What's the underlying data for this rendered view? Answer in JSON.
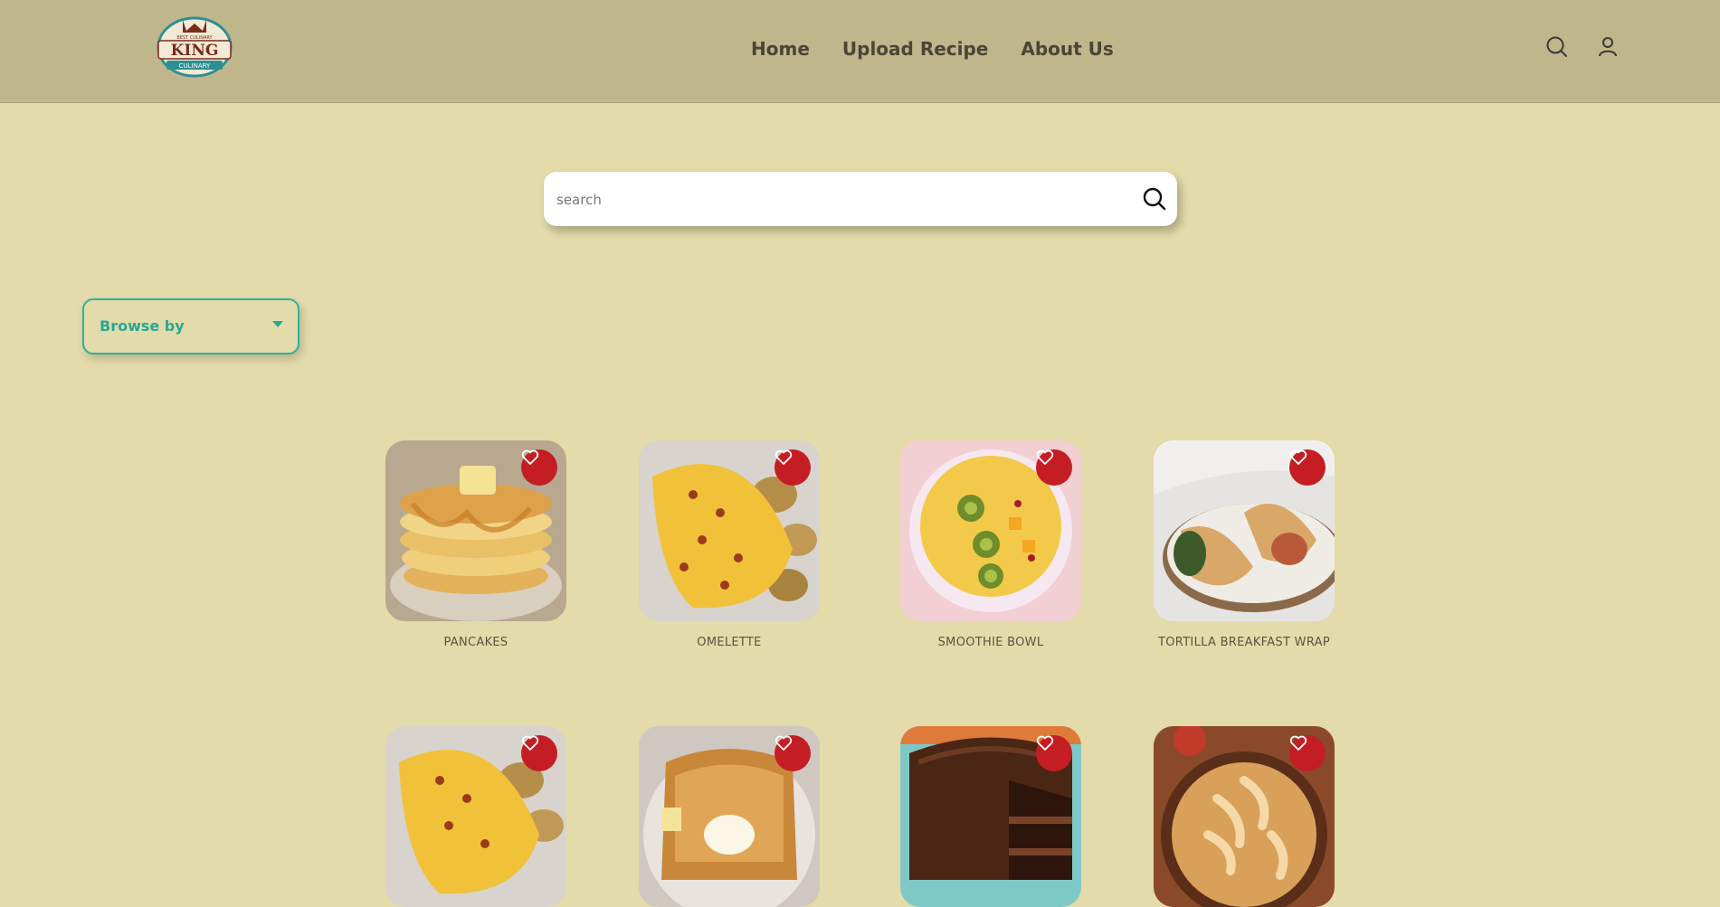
{
  "header": {
    "logo": {
      "title": "KING",
      "subtitle": "CULINARY",
      "tagline": "BEST CULINARY",
      "icon": "crown-logo"
    },
    "nav": [
      {
        "label": "Home"
      },
      {
        "label": "Upload Recipe"
      },
      {
        "label": "About Us"
      }
    ],
    "icons": [
      "search-icon",
      "user-icon"
    ]
  },
  "search": {
    "placeholder": "search",
    "value": ""
  },
  "browse": {
    "label": "Browse by"
  },
  "colors": {
    "accent": "#2db3a0",
    "favorite": "#c41e24",
    "header_bg": "#bfb68b",
    "page_bg": "#e3dba9"
  },
  "recipes": [
    {
      "name": "PANCAKES",
      "image": "pancakes"
    },
    {
      "name": "OMELETTE",
      "image": "omelette"
    },
    {
      "name": "SMOOTHIE BOWL",
      "image": "smoothie-bowl"
    },
    {
      "name": "TORTILLA BREAKFAST WRAP",
      "image": "breakfast-wrap"
    },
    {
      "name": "",
      "image": "omelette"
    },
    {
      "name": "",
      "image": "french-toast"
    },
    {
      "name": "",
      "image": "chocolate-cake"
    },
    {
      "name": "",
      "image": "apple-pie"
    }
  ]
}
